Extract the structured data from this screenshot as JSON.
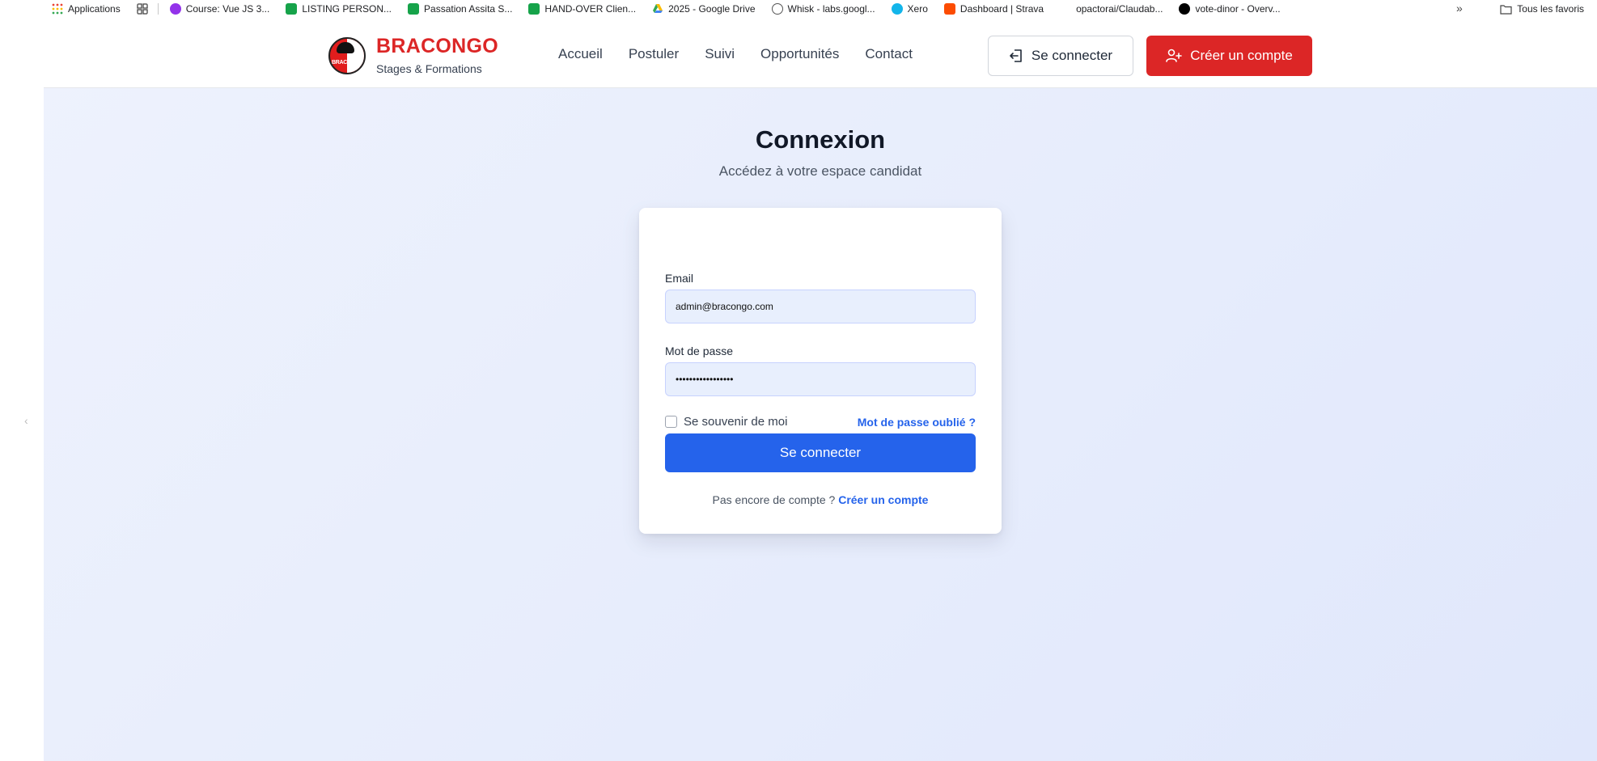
{
  "bookmarks": {
    "items": [
      {
        "label": "Applications",
        "icon": "apps-grid-icon",
        "color": "#ea4335"
      },
      {
        "label": "",
        "icon": "tab-groups-icon",
        "color": "#444444"
      },
      {
        "label": "Course: Vue JS 3...",
        "icon": "course-icon",
        "color": "#9333ea"
      },
      {
        "label": "LISTING PERSON...",
        "icon": "sheets-icon",
        "color": "#16a34a"
      },
      {
        "label": "Passation Assita S...",
        "icon": "sheets-icon",
        "color": "#16a34a"
      },
      {
        "label": "HAND-OVER Clien...",
        "icon": "sheets-icon",
        "color": "#16a34a"
      },
      {
        "label": "2025 - Google Drive",
        "icon": "drive-icon",
        "color": "#fbbc04"
      },
      {
        "label": "Whisk - labs.googl...",
        "icon": "whisk-icon",
        "color": "#555555"
      },
      {
        "label": "Xero",
        "icon": "xero-icon",
        "color": "#13b5ea"
      },
      {
        "label": "Dashboard | Strava",
        "icon": "strava-icon",
        "color": "#fc4c02"
      },
      {
        "label": "opactorai/Claudab...",
        "icon": "github-icon",
        "color": "#ffffff"
      },
      {
        "label": "vote-dinor - Overv...",
        "icon": "vercel-icon",
        "color": "#000000"
      }
    ],
    "all_favorites": "Tous les favoris"
  },
  "header": {
    "brand": "BRACONGO",
    "tagline": "Stages & Formations",
    "logo_text": "BRACONGO",
    "nav": [
      "Accueil",
      "Postuler",
      "Suivi",
      "Opportunités",
      "Contact"
    ],
    "login_label": "Se connecter",
    "signup_label": "Créer un compte"
  },
  "main": {
    "title": "Connexion",
    "subtitle": "Accédez à votre espace candidat",
    "form": {
      "email_label": "Email",
      "email_value": "admin@bracongo.com",
      "password_label": "Mot de passe",
      "password_value": "•••••••••••••••••",
      "remember_label": "Se souvenir de moi",
      "remember_checked": false,
      "forgot_label": "Mot de passe oublié ?",
      "submit_label": "Se connecter",
      "no_account_text": "Pas encore de compte ?",
      "create_account_link": "Créer un compte"
    }
  },
  "colors": {
    "brand_red": "#dc2626",
    "primary_blue": "#2563eb"
  }
}
